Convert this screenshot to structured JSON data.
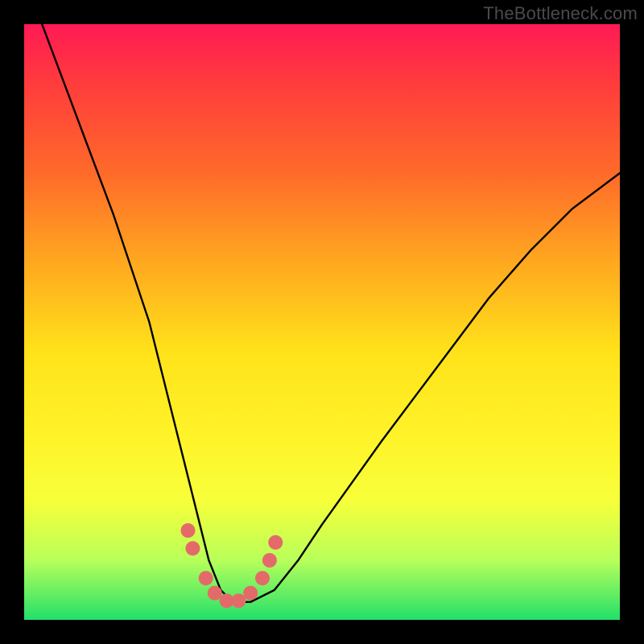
{
  "watermark": "TheBottleneck.com",
  "chart_data": {
    "type": "line",
    "title": "",
    "xlabel": "",
    "ylabel": "",
    "ylim": [
      0,
      100
    ],
    "xlim": [
      0,
      100
    ],
    "series": [
      {
        "name": "bottleneck-curve",
        "x": [
          3,
          6,
          9,
          12,
          15,
          18,
          21,
          23,
          25,
          27,
          29,
          31,
          33,
          35,
          38,
          42,
          46,
          50,
          55,
          60,
          66,
          72,
          78,
          85,
          92,
          100
        ],
        "values": [
          100,
          92,
          84,
          76,
          68,
          59,
          50,
          42,
          34,
          26,
          18,
          10,
          5,
          3,
          3,
          5,
          10,
          16,
          23,
          30,
          38,
          46,
          54,
          62,
          69,
          75
        ]
      }
    ],
    "markers": {
      "name": "highlight-points",
      "x": [
        27.5,
        28.3,
        30.5,
        32,
        34,
        36,
        38,
        40,
        41.2,
        42.2
      ],
      "values": [
        15,
        12,
        7,
        4.5,
        3.2,
        3.2,
        4.5,
        7,
        10,
        13
      ],
      "color": "#e46a6a",
      "radius": 9
    },
    "gradient_stops": [
      {
        "offset": 0,
        "color": "#ff1a55"
      },
      {
        "offset": 10,
        "color": "#ff3c3c"
      },
      {
        "offset": 25,
        "color": "#ff6a2a"
      },
      {
        "offset": 40,
        "color": "#ffa81f"
      },
      {
        "offset": 55,
        "color": "#ffe21a"
      },
      {
        "offset": 70,
        "color": "#fff42a"
      },
      {
        "offset": 80,
        "color": "#f7ff3a"
      },
      {
        "offset": 90,
        "color": "#b8ff5a"
      },
      {
        "offset": 100,
        "color": "#22e06a"
      }
    ]
  }
}
